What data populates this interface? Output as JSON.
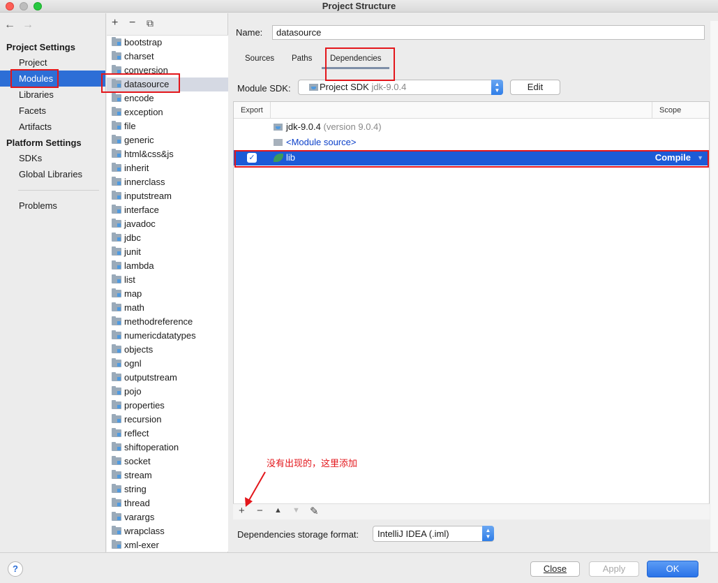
{
  "window": {
    "title": "Project Structure"
  },
  "nav": {
    "back": "←",
    "forward": "→",
    "project_settings_header": "Project Settings",
    "project_items": [
      "Project",
      "Modules",
      "Libraries",
      "Facets",
      "Artifacts"
    ],
    "platform_settings_header": "Platform Settings",
    "platform_items": [
      "SDKs",
      "Global Libraries"
    ],
    "problems": "Problems",
    "selected": "Modules"
  },
  "modules_toolbar": {
    "add": "+",
    "remove": "−",
    "copy": "⧉"
  },
  "modules": [
    "bootstrap",
    "charset",
    "conversion",
    "datasource",
    "encode",
    "exception",
    "file",
    "generic",
    "html&css&js",
    "inherit",
    "innerclass",
    "inputstream",
    "interface",
    "javadoc",
    "jdbc",
    "junit",
    "lambda",
    "list",
    "map",
    "math",
    "methodreference",
    "numericdatatypes",
    "objects",
    "ognl",
    "outputstream",
    "pojo",
    "properties",
    "recursion",
    "reflect",
    "shiftoperation",
    "socket",
    "stream",
    "string",
    "thread",
    "varargs",
    "wrapclass",
    "xml-exer"
  ],
  "selected_module": "datasource",
  "content": {
    "name_label": "Name:",
    "name_value": "datasource",
    "tabs": [
      "Sources",
      "Paths",
      "Dependencies"
    ],
    "active_tab": "Dependencies",
    "sdk_label": "Module SDK:",
    "sdk_value": "Project SDK",
    "sdk_version": "jdk-9.0.4",
    "edit_button": "Edit",
    "table": {
      "col_export": "Export",
      "col_scope": "Scope",
      "rows": [
        {
          "name": "jdk-9.0.4",
          "detail": "(version 9.0.4)"
        },
        {
          "name": "<Module source>"
        },
        {
          "name": "lib",
          "scope": "Compile",
          "exported": true
        }
      ]
    },
    "toolbar": {
      "add": "+",
      "remove": "−",
      "up": "▲",
      "down": "▼",
      "edit": "✎"
    },
    "annotation": "没有出现的，这里添加",
    "storage_label": "Dependencies storage format:",
    "storage_value": "IntelliJ IDEA (.iml)"
  },
  "footer": {
    "help": "?",
    "close": "Close",
    "apply": "Apply",
    "ok": "OK"
  },
  "colors": {
    "selection": "#2d6ed6",
    "table_selection": "#1c5bd7",
    "annotation": "#e3161b"
  }
}
